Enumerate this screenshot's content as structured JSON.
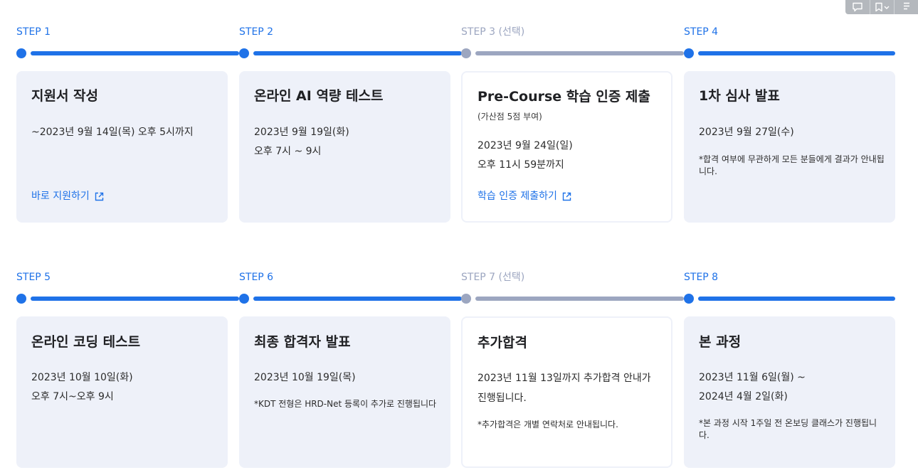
{
  "colors": {
    "accent": "#1f72e8",
    "optional": "#9ca6c0",
    "card_bg": "#eef1f9"
  },
  "toolbar": {
    "icons": [
      "comment-icon",
      "bookmark-dropdown-icon",
      "memo-icon"
    ]
  },
  "steps": [
    {
      "label": "STEP 1",
      "title": "지원서 작성",
      "lines": [
        "~2023년 9월 14일(목) 오후 5시까지"
      ],
      "link": "바로 지원하기"
    },
    {
      "label": "STEP 2",
      "title": "온라인 AI 역량 테스트",
      "lines": [
        "2023년 9월 19일(화)",
        "오후 7시 ~ 9시"
      ]
    },
    {
      "label": "STEP 3 (선택)",
      "title": "Pre-Course 학습 인증 제출",
      "subtitle": "(가산점 5점 부여)",
      "lines": [
        "2023년 9월 24일(일)",
        "오후 11시 59분까지"
      ],
      "link": "학습 인증 제출하기"
    },
    {
      "label": "STEP 4",
      "title": "1차 심사 발표",
      "lines": [
        "2023년 9월 27일(수)"
      ],
      "note": "*합격 여부에 무관하게 모든 분들에게 결과가 안내됩니다."
    },
    {
      "label": "STEP 5",
      "title": "온라인 코딩 테스트",
      "lines": [
        "2023년 10월 10일(화)",
        "오후 7시~오후 9시"
      ]
    },
    {
      "label": "STEP 6",
      "title": "최종 합격자 발표",
      "lines": [
        "2023년 10월 19일(목)"
      ],
      "note": "*KDT 전형은 HRD-Net 등록이 추가로 진행됩니다"
    },
    {
      "label": "STEP 7 (선택)",
      "title": "추가합격",
      "lines": [
        "2023년 11월 13일까지 추가합격 안내가 진행됩니다."
      ],
      "note": "*추가합격은 개별 연락처로 안내됩니다."
    },
    {
      "label": "STEP 8",
      "title": "본 과정",
      "lines": [
        "2023년 11월 6일(월) ~",
        "2024년 4월 2일(화)"
      ],
      "note": "*본 과정 시작 1주일 전 온보딩 클래스가 진행됩니다."
    }
  ]
}
